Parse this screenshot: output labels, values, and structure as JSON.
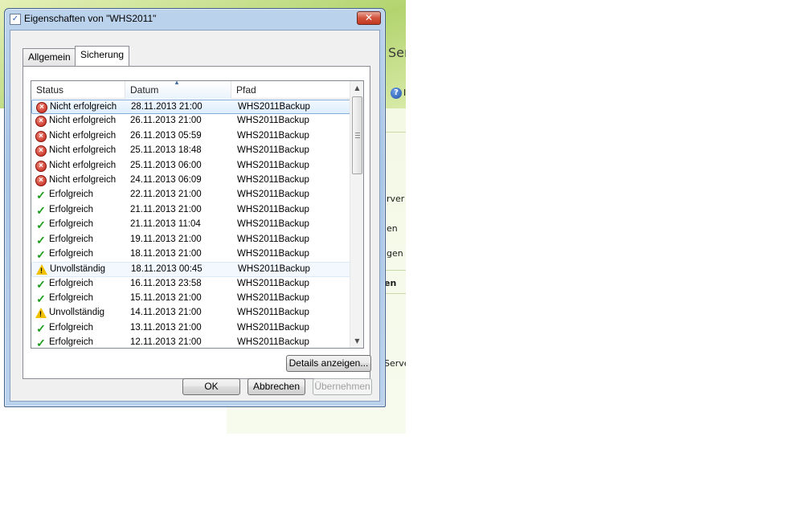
{
  "background": {
    "fragments": [
      "Serv",
      "rver",
      "en",
      "gen",
      "en",
      "Server",
      "I"
    ]
  },
  "dialog": {
    "title": "Eigenschaften von \"WHS2011\"",
    "close_glyph": "✕",
    "tabs": [
      {
        "label": "Allgemein",
        "active": false
      },
      {
        "label": "Sicherung",
        "active": true
      }
    ],
    "list": {
      "columns": [
        "Status",
        "Datum",
        "Pfad"
      ],
      "sorted_column": "Datum",
      "rows": [
        {
          "status": "Nicht erfolgreich",
          "icon": "error-icon",
          "date": "28.11.2013 21:00",
          "path": "WHS2011Backup",
          "state": "selected"
        },
        {
          "status": "Nicht erfolgreich",
          "icon": "error-icon",
          "date": "26.11.2013 21:00",
          "path": "WHS2011Backup",
          "state": ""
        },
        {
          "status": "Nicht erfolgreich",
          "icon": "error-icon",
          "date": "26.11.2013 05:59",
          "path": "WHS2011Backup",
          "state": ""
        },
        {
          "status": "Nicht erfolgreich",
          "icon": "error-icon",
          "date": "25.11.2013 18:48",
          "path": "WHS2011Backup",
          "state": ""
        },
        {
          "status": "Nicht erfolgreich",
          "icon": "error-icon",
          "date": "25.11.2013 06:00",
          "path": "WHS2011Backup",
          "state": ""
        },
        {
          "status": "Nicht erfolgreich",
          "icon": "error-icon",
          "date": "24.11.2013 06:09",
          "path": "WHS2011Backup",
          "state": ""
        },
        {
          "status": "Erfolgreich",
          "icon": "checkmark-icon",
          "date": "22.11.2013 21:00",
          "path": "WHS2011Backup",
          "state": ""
        },
        {
          "status": "Erfolgreich",
          "icon": "checkmark-icon",
          "date": "21.11.2013 21:00",
          "path": "WHS2011Backup",
          "state": ""
        },
        {
          "status": "Erfolgreich",
          "icon": "checkmark-icon",
          "date": "21.11.2013 11:04",
          "path": "WHS2011Backup",
          "state": ""
        },
        {
          "status": "Erfolgreich",
          "icon": "checkmark-icon",
          "date": "19.11.2013 21:00",
          "path": "WHS2011Backup",
          "state": ""
        },
        {
          "status": "Erfolgreich",
          "icon": "checkmark-icon",
          "date": "18.11.2013 21:00",
          "path": "WHS2011Backup",
          "state": ""
        },
        {
          "status": "Unvollständig",
          "icon": "warning-icon",
          "date": "18.11.2013 00:45",
          "path": "WHS2011Backup",
          "state": "hover"
        },
        {
          "status": "Erfolgreich",
          "icon": "checkmark-icon",
          "date": "16.11.2013 23:58",
          "path": "WHS2011Backup",
          "state": ""
        },
        {
          "status": "Erfolgreich",
          "icon": "checkmark-icon",
          "date": "15.11.2013 21:00",
          "path": "WHS2011Backup",
          "state": ""
        },
        {
          "status": "Unvollständig",
          "icon": "warning-icon",
          "date": "14.11.2013 21:00",
          "path": "WHS2011Backup",
          "state": ""
        },
        {
          "status": "Erfolgreich",
          "icon": "checkmark-icon",
          "date": "13.11.2013 21:00",
          "path": "WHS2011Backup",
          "state": ""
        },
        {
          "status": "Erfolgreich",
          "icon": "checkmark-icon",
          "date": "12.11.2013 21:00",
          "path": "WHS2011Backup",
          "state": ""
        }
      ]
    },
    "details_button": "Details anzeigen...",
    "buttons": {
      "ok": "OK",
      "cancel": "Abbrechen",
      "apply": "Übernehmen"
    }
  },
  "colors": {
    "error": "#c01f13",
    "success": "#1c9c1c",
    "warning": "#f2c200",
    "selection_border": "#84acdd"
  }
}
